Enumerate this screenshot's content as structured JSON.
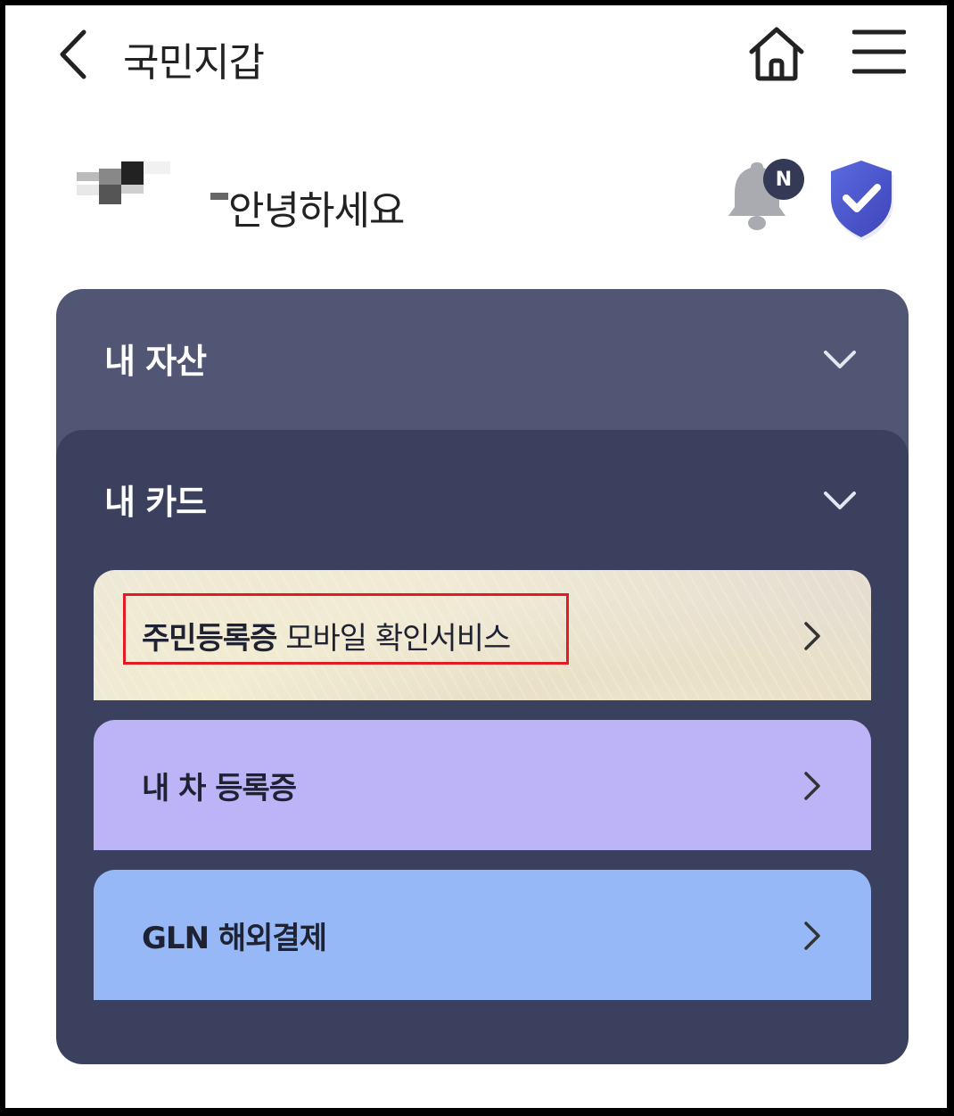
{
  "header": {
    "title": "국민지갑",
    "back_icon": "chevron-left-icon",
    "home_icon": "home-icon",
    "menu_icon": "hamburger-menu-icon"
  },
  "greeting": {
    "text": "안녕하세요",
    "notification_badge": "N",
    "bell_icon": "bell-icon",
    "shield_icon": "shield-check-icon"
  },
  "sections": {
    "assets": {
      "title": "내 자산"
    },
    "cards": {
      "title": "내 카드"
    }
  },
  "cards": [
    {
      "label_bold": "주민등록증",
      "label_rest": " 모바일 확인서비스"
    },
    {
      "label": "내 차 등록증"
    },
    {
      "label": "GLN 해외결제"
    }
  ],
  "colors": {
    "assets_bg": "#505673",
    "cards_bg": "#3a405d",
    "car_card": "#bdb3f7",
    "gln_card": "#97b8f7",
    "shield": "#4f5bd5",
    "highlight": "#e31c23"
  }
}
